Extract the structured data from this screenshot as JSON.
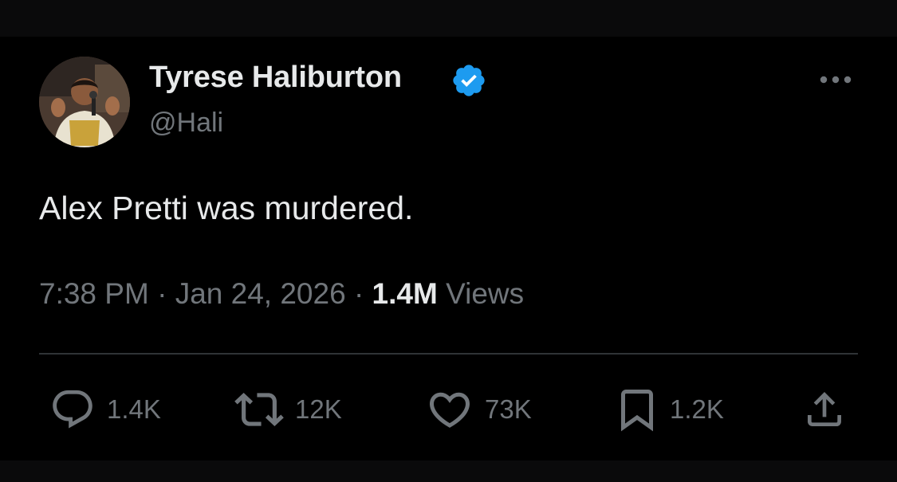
{
  "tweet": {
    "author": {
      "display_name": "Tyrese Haliburton",
      "handle": "@Hali",
      "verified": true
    },
    "text": "Alex Pretti was murdered.",
    "time": "7:38 PM",
    "date": "Jan 24, 2026",
    "separator": "·",
    "views_count": "1.4M",
    "views_label": "Views",
    "actions": {
      "reply_count": "1.4K",
      "retweet_count": "12K",
      "like_count": "73K",
      "bookmark_count": "1.2K"
    }
  },
  "icons": {
    "verified": "verified-badge-icon",
    "more": "more-options-icon",
    "reply": "reply-icon",
    "retweet": "retweet-icon",
    "like": "heart-icon",
    "bookmark": "bookmark-icon",
    "share": "share-icon"
  },
  "colors": {
    "background": "#000000",
    "primary_text": "#e7e9ea",
    "secondary_text": "#71767b",
    "divider": "#2f3336",
    "verified_blue": "#1d9bf0"
  }
}
